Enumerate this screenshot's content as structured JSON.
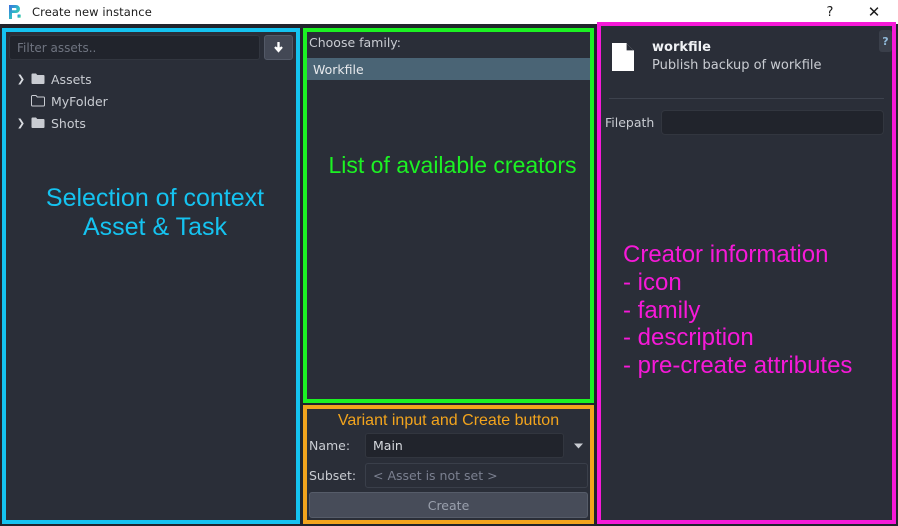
{
  "window": {
    "title": "Create new instance",
    "logo_icon": "openpype-p-logo-icon",
    "help_label": "?",
    "close_label": "✕"
  },
  "left_panel": {
    "accent_color": "#15c3f0",
    "filter": {
      "placeholder": "Filter assets..",
      "value": "",
      "dropdown_icon": "arrow-down-icon"
    },
    "tree_items": [
      {
        "label": "Assets",
        "expandable": true,
        "arrow": "❯",
        "folder_icon": "folder-filled-icon"
      },
      {
        "label": "MyFolder",
        "expandable": false,
        "arrow": "",
        "folder_icon": "folder-outline-icon"
      },
      {
        "label": "Shots",
        "expandable": true,
        "arrow": "❯",
        "folder_icon": "folder-filled-icon"
      }
    ],
    "annotation": "Selection of context\nAsset & Task"
  },
  "middle_panel": {
    "accent_color": "#1cf223",
    "family_label": "Choose family:",
    "families": [
      {
        "label": "Workfile",
        "selected": true
      }
    ],
    "annotation": "List of available creators"
  },
  "bottom_panel": {
    "accent_color": "#f2a41d",
    "annotation": "Variant input and Create button",
    "name_label": "Name:",
    "name_value": "Main",
    "name_dropdown_icon": "chevron-down-icon",
    "subset_label": "Subset:",
    "subset_value": "< Asset is not set >",
    "create_label": "Create"
  },
  "right_panel": {
    "accent_color": "#f619d8",
    "creator_icon": "document-file-icon",
    "creator_family": "workfile",
    "creator_description": "Publish backup of workfile",
    "help_label": "?",
    "attribute": {
      "label": "Filepath",
      "value": ""
    },
    "annotation_lines": [
      "Creator information",
      "- icon",
      "- family",
      "- description",
      "- pre-create attributes"
    ]
  }
}
